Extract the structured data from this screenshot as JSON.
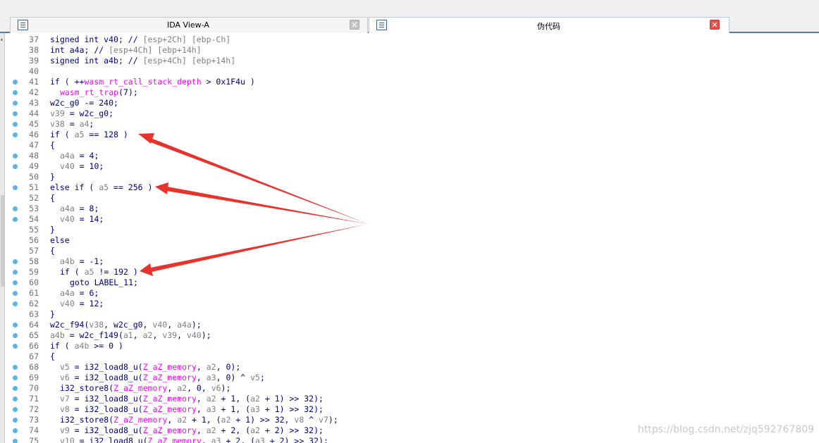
{
  "tabs": [
    {
      "label": "IDA View-A",
      "active": false
    },
    {
      "label": "伪代码",
      "active": true
    }
  ],
  "close_symbol": "✕",
  "colors": {
    "accent": "#4a7fb8",
    "arrow": "#e8322c",
    "variable": "#808080",
    "global": "#ff00ff",
    "keyword": "#000080"
  },
  "code_lines": [
    {
      "num": "37",
      "bp": false,
      "tokens": [
        [
          "d",
          "signed int "
        ],
        [
          "d",
          "v40"
        ],
        [
          "d",
          "; // "
        ],
        [
          "r",
          "[esp+2Ch] [ebp-Ch]"
        ]
      ]
    },
    {
      "num": "38",
      "bp": false,
      "tokens": [
        [
          "d",
          "int "
        ],
        [
          "d",
          "a4a"
        ],
        [
          "d",
          "; // "
        ],
        [
          "r",
          "[esp+4Ch] [ebp+14h]"
        ]
      ]
    },
    {
      "num": "39",
      "bp": false,
      "tokens": [
        [
          "d",
          "signed int "
        ],
        [
          "d",
          "a4b"
        ],
        [
          "d",
          "; // "
        ],
        [
          "r",
          "[esp+4Ch] [ebp+14h]"
        ]
      ]
    },
    {
      "num": "40",
      "bp": false,
      "tokens": []
    },
    {
      "num": "41",
      "bp": true,
      "tokens": [
        [
          "d",
          "if ( ++"
        ],
        [
          "g",
          "wasm_rt_call_stack_depth"
        ],
        [
          "d",
          " > 0x1F4u )"
        ]
      ]
    },
    {
      "num": "42",
      "bp": true,
      "indent": 1,
      "tokens": [
        [
          "g",
          "wasm_rt_trap"
        ],
        [
          "d",
          "(7);"
        ]
      ]
    },
    {
      "num": "43",
      "bp": true,
      "tokens": [
        [
          "d",
          "w2c_g0 -= 240;"
        ]
      ]
    },
    {
      "num": "44",
      "bp": true,
      "tokens": [
        [
          "v",
          "v39"
        ],
        [
          "d",
          " = w2c_g0;"
        ]
      ]
    },
    {
      "num": "45",
      "bp": true,
      "tokens": [
        [
          "v",
          "v38"
        ],
        [
          "d",
          " = "
        ],
        [
          "v",
          "a4"
        ],
        [
          "d",
          ";"
        ]
      ]
    },
    {
      "num": "46",
      "bp": true,
      "tokens": [
        [
          "d",
          "if ( "
        ],
        [
          "v",
          "a5"
        ],
        [
          "d",
          " == 128 )"
        ]
      ]
    },
    {
      "num": "47",
      "bp": false,
      "tokens": [
        [
          "d",
          "{"
        ]
      ]
    },
    {
      "num": "48",
      "bp": true,
      "indent": 1,
      "tokens": [
        [
          "v",
          "a4a"
        ],
        [
          "d",
          " = 4;"
        ]
      ]
    },
    {
      "num": "49",
      "bp": true,
      "indent": 1,
      "tokens": [
        [
          "v",
          "v40"
        ],
        [
          "d",
          " = 10;"
        ]
      ]
    },
    {
      "num": "50",
      "bp": false,
      "tokens": [
        [
          "d",
          "}"
        ]
      ]
    },
    {
      "num": "51",
      "bp": true,
      "tokens": [
        [
          "d",
          "else if ( "
        ],
        [
          "v",
          "a5"
        ],
        [
          "d",
          " == 256 )"
        ]
      ]
    },
    {
      "num": "52",
      "bp": false,
      "tokens": [
        [
          "d",
          "{"
        ]
      ]
    },
    {
      "num": "53",
      "bp": true,
      "indent": 1,
      "tokens": [
        [
          "v",
          "a4a"
        ],
        [
          "d",
          " = 8;"
        ]
      ]
    },
    {
      "num": "54",
      "bp": true,
      "indent": 1,
      "tokens": [
        [
          "v",
          "v40"
        ],
        [
          "d",
          " = 14;"
        ]
      ]
    },
    {
      "num": "55",
      "bp": false,
      "tokens": [
        [
          "d",
          "}"
        ]
      ]
    },
    {
      "num": "56",
      "bp": false,
      "tokens": [
        [
          "d",
          "else"
        ]
      ]
    },
    {
      "num": "57",
      "bp": false,
      "tokens": [
        [
          "d",
          "{"
        ]
      ]
    },
    {
      "num": "58",
      "bp": true,
      "indent": 1,
      "tokens": [
        [
          "v",
          "a4b"
        ],
        [
          "d",
          " = -1;"
        ]
      ]
    },
    {
      "num": "59",
      "bp": true,
      "indent": 1,
      "tokens": [
        [
          "d",
          "if ( "
        ],
        [
          "v",
          "a5"
        ],
        [
          "d",
          " != 192 )"
        ]
      ]
    },
    {
      "num": "60",
      "bp": true,
      "indent": 2,
      "tokens": [
        [
          "d",
          "goto LABEL_11;"
        ]
      ]
    },
    {
      "num": "61",
      "bp": true,
      "indent": 1,
      "tokens": [
        [
          "v",
          "a4a"
        ],
        [
          "d",
          " = 6;"
        ]
      ]
    },
    {
      "num": "62",
      "bp": true,
      "indent": 1,
      "tokens": [
        [
          "v",
          "v40"
        ],
        [
          "d",
          " = 12;"
        ]
      ]
    },
    {
      "num": "63",
      "bp": false,
      "tokens": [
        [
          "d",
          "}"
        ]
      ]
    },
    {
      "num": "64",
      "bp": true,
      "tokens": [
        [
          "d",
          "w2c_f94("
        ],
        [
          "v",
          "v38"
        ],
        [
          "d",
          ", w2c_g0, "
        ],
        [
          "v",
          "v40"
        ],
        [
          "d",
          ", "
        ],
        [
          "v",
          "a4a"
        ],
        [
          "d",
          ");"
        ]
      ]
    },
    {
      "num": "65",
      "bp": true,
      "tokens": [
        [
          "v",
          "a4b"
        ],
        [
          "d",
          " = w2c_f149("
        ],
        [
          "v",
          "a1"
        ],
        [
          "d",
          ", "
        ],
        [
          "v",
          "a2"
        ],
        [
          "d",
          ", "
        ],
        [
          "v",
          "v39"
        ],
        [
          "d",
          ", "
        ],
        [
          "v",
          "v40"
        ],
        [
          "d",
          ");"
        ]
      ]
    },
    {
      "num": "66",
      "bp": true,
      "tokens": [
        [
          "d",
          "if ( "
        ],
        [
          "v",
          "a4b"
        ],
        [
          "d",
          " >= 0 )"
        ]
      ]
    },
    {
      "num": "67",
      "bp": false,
      "tokens": [
        [
          "d",
          "{"
        ]
      ]
    },
    {
      "num": "68",
      "bp": true,
      "indent": 1,
      "tokens": [
        [
          "v",
          "v5"
        ],
        [
          "d",
          " = i32_load8_u("
        ],
        [
          "g",
          "Z_aZ_memory"
        ],
        [
          "d",
          ", "
        ],
        [
          "v",
          "a2"
        ],
        [
          "d",
          ", 0);"
        ]
      ]
    },
    {
      "num": "69",
      "bp": true,
      "indent": 1,
      "tokens": [
        [
          "v",
          "v6"
        ],
        [
          "d",
          " = i32_load8_u("
        ],
        [
          "g",
          "Z_aZ_memory"
        ],
        [
          "d",
          ", "
        ],
        [
          "v",
          "a3"
        ],
        [
          "d",
          ", 0) ^ "
        ],
        [
          "v",
          "v5"
        ],
        [
          "d",
          ";"
        ]
      ]
    },
    {
      "num": "70",
      "bp": true,
      "indent": 1,
      "tokens": [
        [
          "d",
          "i32_store8("
        ],
        [
          "g",
          "Z_aZ_memory"
        ],
        [
          "d",
          ", "
        ],
        [
          "v",
          "a2"
        ],
        [
          "d",
          ", 0, "
        ],
        [
          "v",
          "v6"
        ],
        [
          "d",
          ");"
        ]
      ]
    },
    {
      "num": "71",
      "bp": true,
      "indent": 1,
      "tokens": [
        [
          "v",
          "v7"
        ],
        [
          "d",
          " = i32_load8_u("
        ],
        [
          "g",
          "Z_aZ_memory"
        ],
        [
          "d",
          ", "
        ],
        [
          "v",
          "a2"
        ],
        [
          "d",
          " + 1, ("
        ],
        [
          "v",
          "a2"
        ],
        [
          "d",
          " + 1) >> 32);"
        ]
      ]
    },
    {
      "num": "72",
      "bp": true,
      "indent": 1,
      "tokens": [
        [
          "v",
          "v8"
        ],
        [
          "d",
          " = i32_load8_u("
        ],
        [
          "g",
          "Z_aZ_memory"
        ],
        [
          "d",
          ", "
        ],
        [
          "v",
          "a3"
        ],
        [
          "d",
          " + 1, ("
        ],
        [
          "v",
          "a3"
        ],
        [
          "d",
          " + 1) >> 32);"
        ]
      ]
    },
    {
      "num": "73",
      "bp": true,
      "indent": 1,
      "tokens": [
        [
          "d",
          "i32_store8("
        ],
        [
          "g",
          "Z_aZ_memory"
        ],
        [
          "d",
          ", "
        ],
        [
          "v",
          "a2"
        ],
        [
          "d",
          " + 1, ("
        ],
        [
          "v",
          "a2"
        ],
        [
          "d",
          " + 1) >> 32, "
        ],
        [
          "v",
          "v8"
        ],
        [
          "d",
          " ^ "
        ],
        [
          "v",
          "v7"
        ],
        [
          "d",
          ");"
        ]
      ]
    },
    {
      "num": "74",
      "bp": true,
      "indent": 1,
      "tokens": [
        [
          "v",
          "v9"
        ],
        [
          "d",
          " = i32_load8_u("
        ],
        [
          "g",
          "Z_aZ_memory"
        ],
        [
          "d",
          ", "
        ],
        [
          "v",
          "a2"
        ],
        [
          "d",
          " + 2, ("
        ],
        [
          "v",
          "a2"
        ],
        [
          "d",
          " + 2) >> 32);"
        ]
      ]
    },
    {
      "num": "75",
      "bp": true,
      "indent": 1,
      "tokens": [
        [
          "v",
          "v10"
        ],
        [
          "d",
          " = i32_load8_u("
        ],
        [
          "g",
          "Z_aZ_memory"
        ],
        [
          "d",
          ", "
        ],
        [
          "v",
          "a3"
        ],
        [
          "d",
          " + 2, ("
        ],
        [
          "v",
          "a3"
        ],
        [
          "d",
          " + 2) >> 32);"
        ]
      ]
    }
  ],
  "watermark": "https://blog.csdn.net/zjq592767809"
}
